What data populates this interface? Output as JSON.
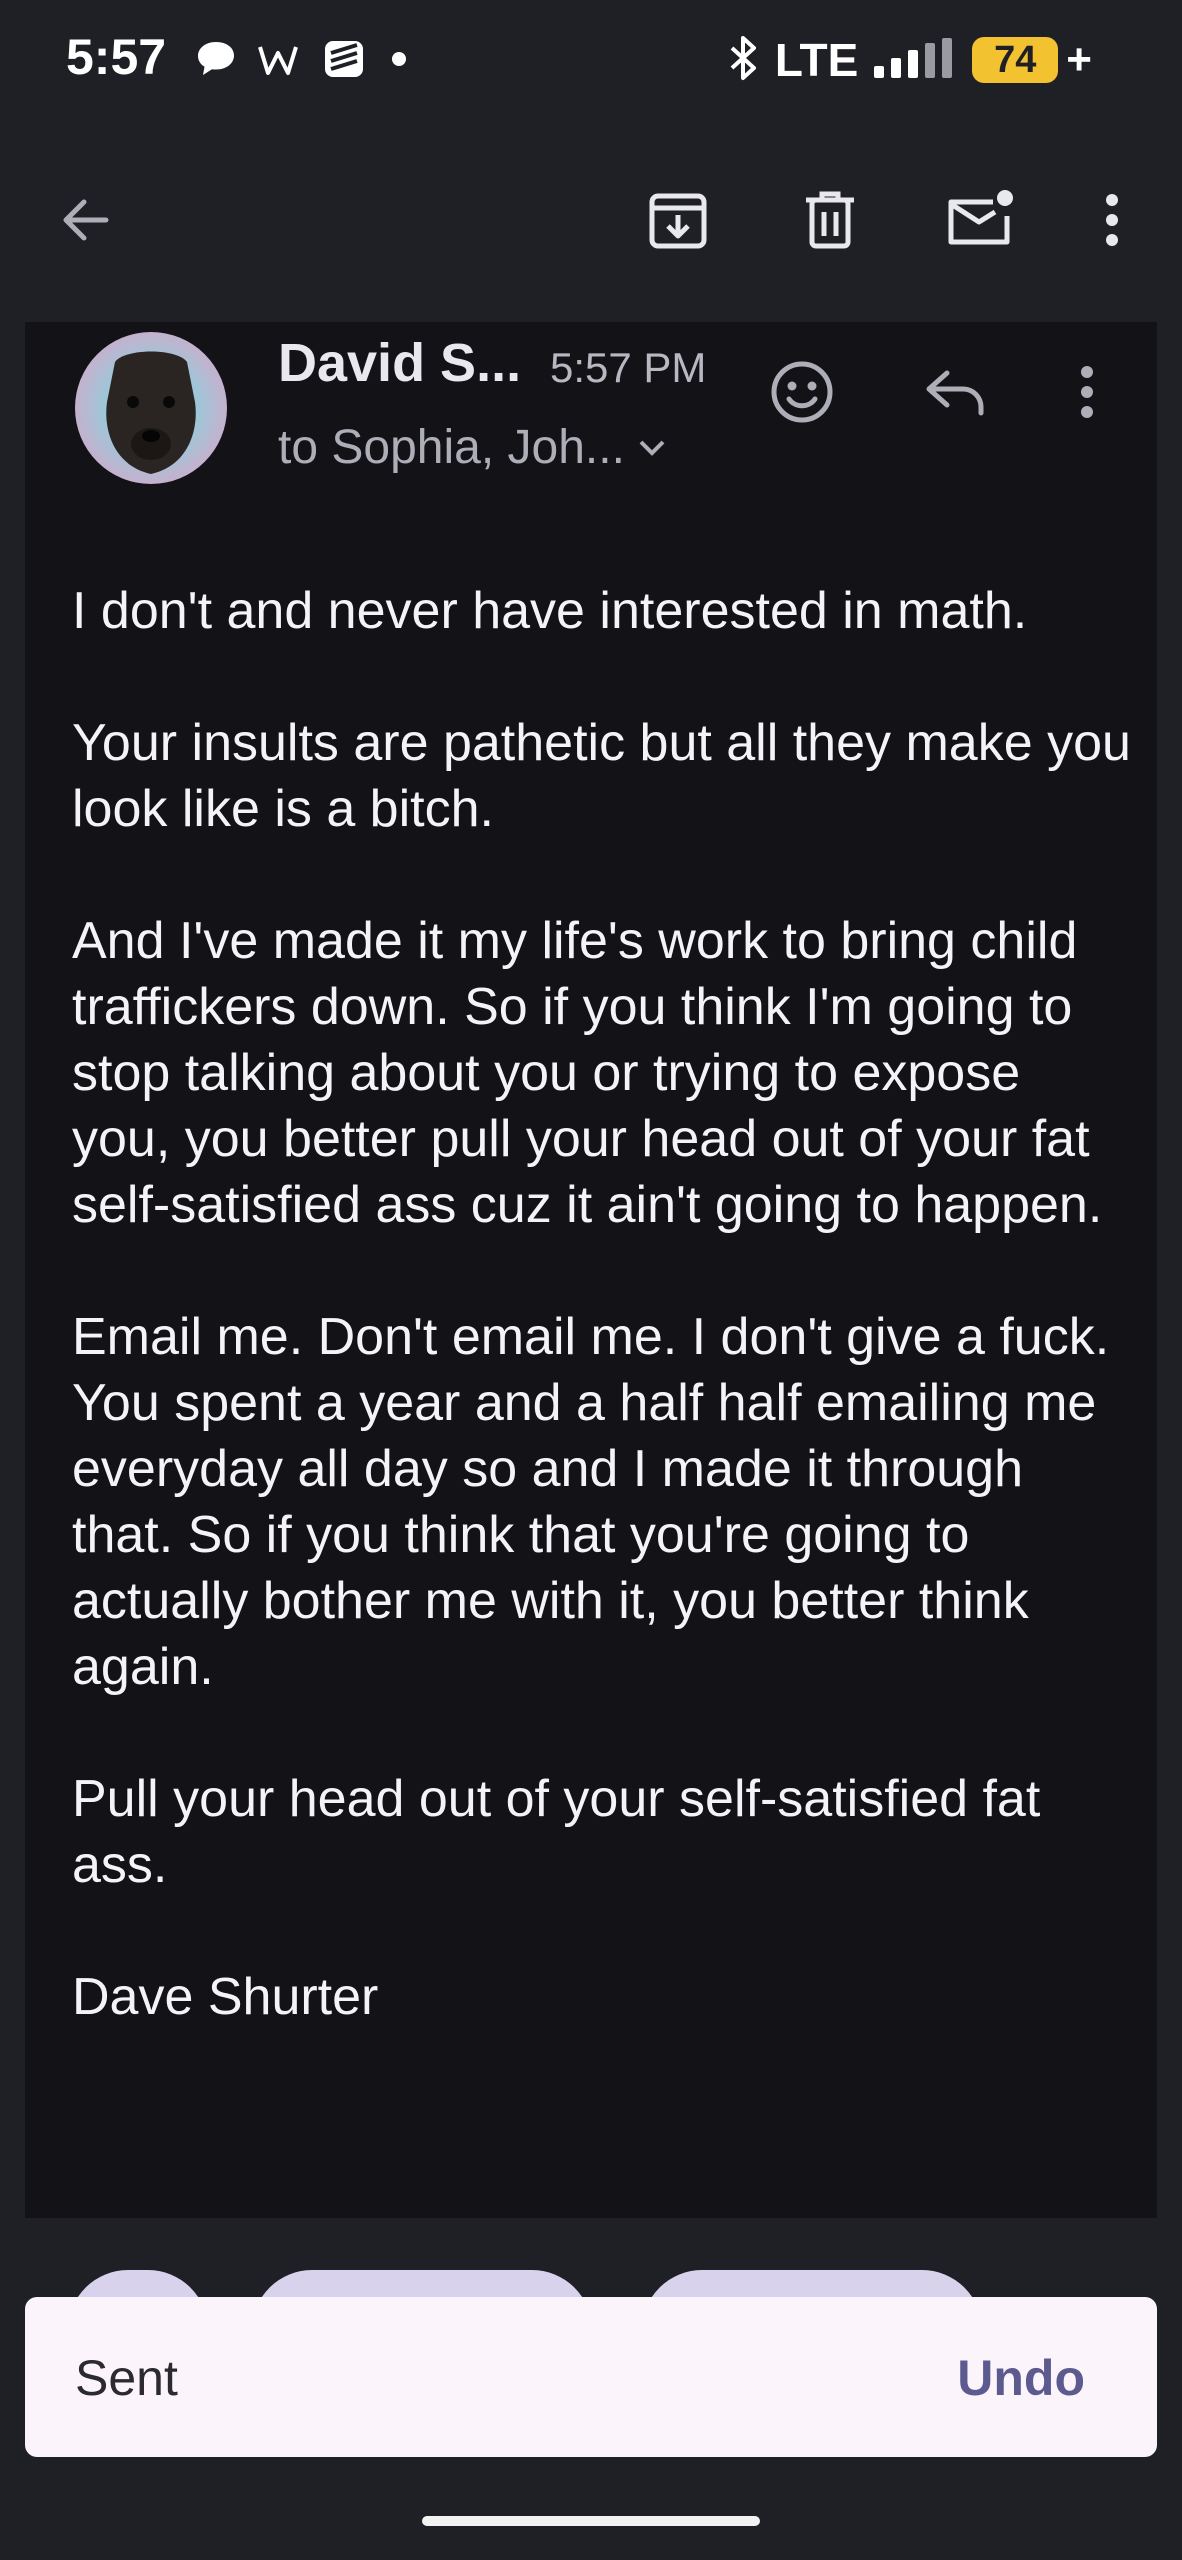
{
  "status_bar": {
    "time": "5:57",
    "network": "LTE",
    "battery": "74",
    "battery_suffix": "+",
    "battery_color": "#f2c230",
    "left_icons": [
      "chat-bubble-icon",
      "w-app-icon",
      "stack-app-icon",
      "dot-icon"
    ],
    "right_icons": [
      "bluetooth-icon",
      "signal-icon"
    ]
  },
  "toolbar": {
    "icons": [
      "back-arrow-icon",
      "archive-icon",
      "delete-icon",
      "mark-unread-icon",
      "more-vert-icon"
    ]
  },
  "message": {
    "sender": "David S...",
    "time": "5:57 PM",
    "recipients": "to Sophia, Joh...",
    "paragraphs": [
      "I don't and never have interested in math.",
      "Your insults are pathetic but all they make you look like is a bitch.",
      "And I've made it my life's work to bring child traffickers down. So if you think I'm going to stop talking about you or trying to expose you, you better pull your head out of your fat self-satisfied ass cuz it ain't going to happen.",
      "Email me. Don't email me. I don't give a fuck. You spent a year and a half half emailing me everyday all day so and I made it through that. So if you think that you're going to actually bother me with it, you better think again.",
      "Pull your head out of your self-satisfied fat ass.",
      "Dave Shurter"
    ]
  },
  "snackbar": {
    "text": "Sent",
    "action": "Undo",
    "action_color": "#5c5a8e"
  }
}
